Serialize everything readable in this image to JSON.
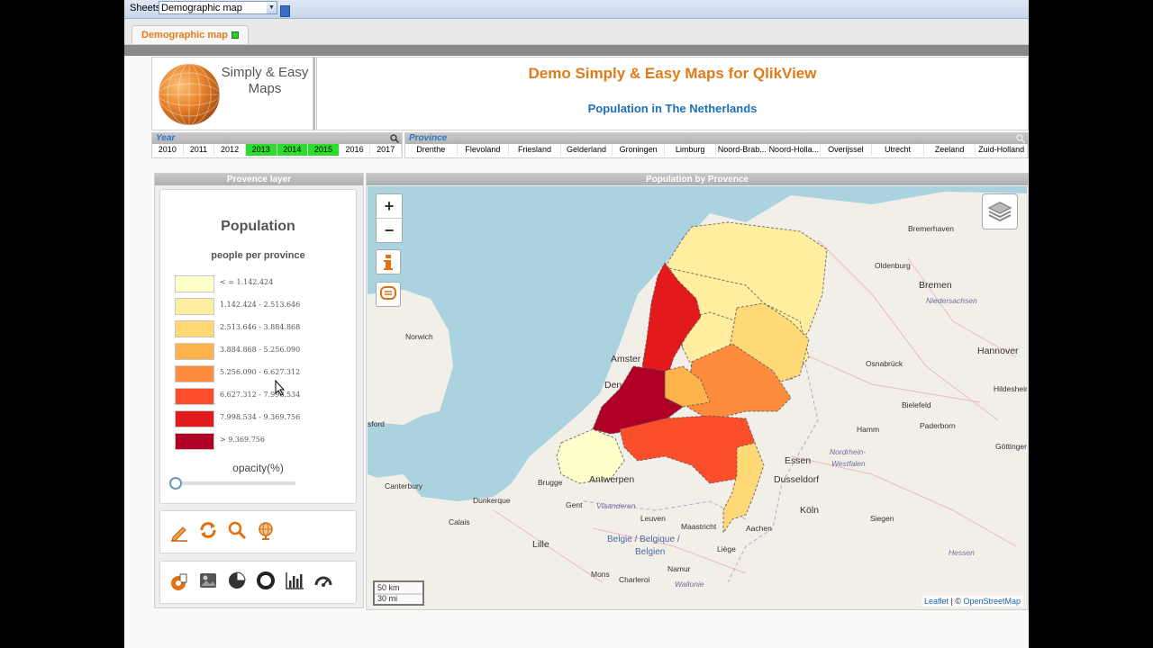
{
  "toolbar": {
    "sheets_label": "Sheets",
    "sheets_value": "Demographic map"
  },
  "tabs": [
    {
      "label": "Demographic map",
      "active": true
    }
  ],
  "logo": {
    "line1": "Simply & Easy",
    "line2": "Maps"
  },
  "header": {
    "title": "Demo Simply & Easy Maps for QlikView",
    "subtitle": "Population in The Netherlands"
  },
  "year_listbox": {
    "title": "Year",
    "items": [
      {
        "label": "2010",
        "selected": false
      },
      {
        "label": "2011",
        "selected": false
      },
      {
        "label": "2012",
        "selected": false
      },
      {
        "label": "2013",
        "selected": true
      },
      {
        "label": "2014",
        "selected": true
      },
      {
        "label": "2015",
        "selected": true
      },
      {
        "label": "2016",
        "selected": false
      },
      {
        "label": "2017",
        "selected": false
      }
    ]
  },
  "province_listbox": {
    "title": "Province",
    "items": [
      "Drenthe",
      "Flevoland",
      "Friesland",
      "Gelderland",
      "Groningen",
      "Limburg",
      "Noord-Brab...",
      "Noord-Holla...",
      "Overijssel",
      "Utrecht",
      "Zeeland",
      "Zuid-Holland"
    ]
  },
  "legend_panel": {
    "header": "Provence layer",
    "title": "Population",
    "subtitle": "people per province",
    "classes": [
      {
        "label": "< = 1.142.424",
        "color": "#ffffcc"
      },
      {
        "label": "1.142.424 - 2.513.646",
        "color": "#ffeda0"
      },
      {
        "label": "2.513.646 - 3.884.868",
        "color": "#fed976"
      },
      {
        "label": "3.884.868 - 5.256.090",
        "color": "#feb24c"
      },
      {
        "label": "5.256.090 - 6.627.312",
        "color": "#fd8d3c"
      },
      {
        "label": "6.627.312 - 7.998.534",
        "color": "#fc4e2a"
      },
      {
        "label": "7.998.534 - 9.369.756",
        "color": "#e31a1c"
      },
      {
        "label": "> 9.369.756",
        "color": "#b10026"
      }
    ],
    "opacity_label": "opacity(%)",
    "opacity_value": 0,
    "tools_row1": [
      "pencil-icon",
      "refresh-icon",
      "magnifier-icon",
      "globe-icon"
    ],
    "tools_row2": [
      "map-marker-icon",
      "image-icon",
      "pie-chart-icon",
      "donut-chart-icon",
      "bar-chart-icon",
      "gauge-icon"
    ]
  },
  "map_panel": {
    "header": "Population by Provence",
    "zoom_in": "+",
    "zoom_out": "−",
    "scale_km": "50 km",
    "scale_mi": "30 mi",
    "attribution_leaflet": "Leaflet",
    "attribution_sep": " | © ",
    "attribution_osm": "OpenStreetMap",
    "labels": [
      "Bremerhaven",
      "Oldenburg",
      "Bremen",
      "Niedersachsen",
      "Hannover",
      "Osnabrück",
      "Hildesheim",
      "Bielefeld",
      "Paderborn",
      "Hamm",
      "Göttinger",
      "Nordrhein-",
      "Westfalen",
      "Essen",
      "Dusseldorf",
      "Köln",
      "Siegen",
      "Hessen",
      "Norwich",
      "Amster",
      "Den",
      "sford",
      "Canterbury",
      "Brugge",
      "Antwerpen",
      "Gent",
      "Dunkerque",
      "Vlaanderen",
      "Calais",
      "Leuven",
      "Maastricht",
      "Lille",
      "Belgie / Belgique /",
      "Belgien",
      "Liège",
      "Namur",
      "Mons",
      "Charleroi",
      "Wallonie",
      "Aachen"
    ]
  }
}
